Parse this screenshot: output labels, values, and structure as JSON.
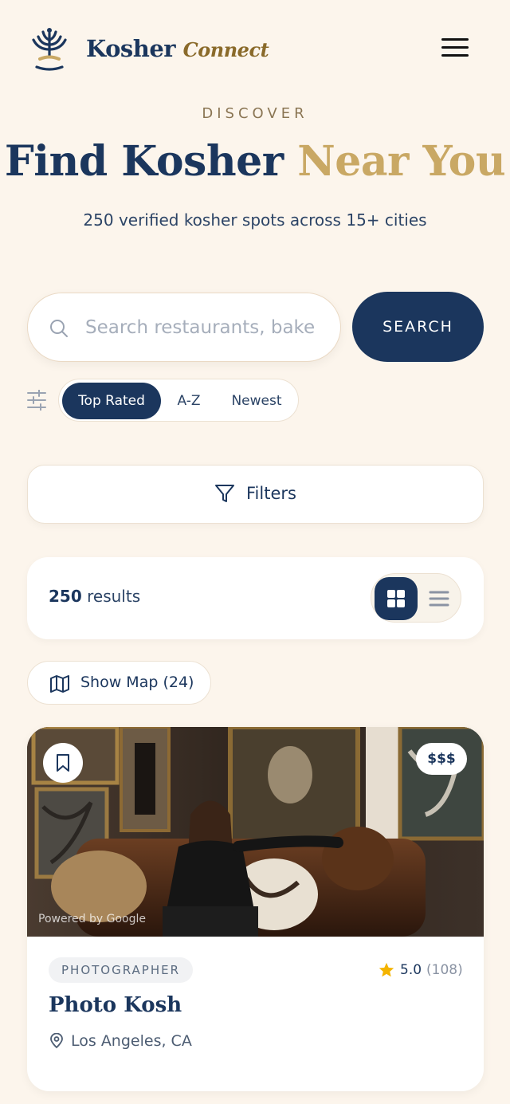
{
  "header": {
    "brand_main": "Kosher",
    "brand_accent": "Connect",
    "logo_icon": "menorah-logo-icon",
    "menu_icon": "hamburger-menu-icon"
  },
  "hero": {
    "eyebrow": "DISCOVER",
    "title_main": "Find Kosher",
    "title_accent": "Near You",
    "subtitle": "250 verified kosher spots across 15+ cities"
  },
  "search": {
    "placeholder": "Search restaurants, bake",
    "button_label": "SEARCH",
    "icon": "search-icon"
  },
  "sort": {
    "icon": "sliders-icon",
    "options": [
      "Top Rated",
      "A-Z",
      "Newest"
    ],
    "active": "Top Rated"
  },
  "filters": {
    "label": "Filters",
    "icon": "funnel-icon"
  },
  "results": {
    "count": "250",
    "label": "results",
    "view_mode": "grid"
  },
  "map": {
    "label": "Show Map (24)",
    "icon": "map-icon"
  },
  "listing": {
    "price": "$$$",
    "powered_by": "Powered by Google",
    "category": "PHOTOGRAPHER",
    "rating": "5.0",
    "reviews": "(108)",
    "name": "Photo Kosh",
    "location": "Los Angeles, CA"
  },
  "colors": {
    "background": "#fcf5ec",
    "navy": "#1b365d",
    "gold": "#c9a864",
    "star": "#f4b400"
  }
}
